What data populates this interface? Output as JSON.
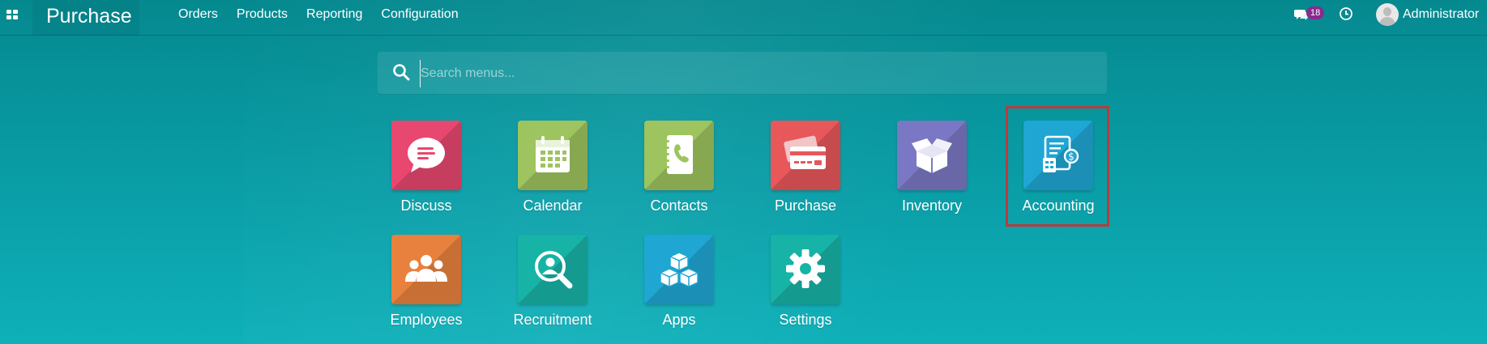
{
  "navbar": {
    "brand": "Purchase",
    "menu": [
      "Orders",
      "Products",
      "Reporting",
      "Configuration"
    ],
    "messages_count": "18",
    "user_name": "Administrator"
  },
  "search": {
    "placeholder": "Search menus..."
  },
  "apps": [
    {
      "label": "Discuss",
      "color": "#e8476f",
      "icon": "discuss-icon"
    },
    {
      "label": "Calendar",
      "color": "#9dc45e",
      "icon": "calendar-icon"
    },
    {
      "label": "Contacts",
      "color": "#9dc45e",
      "icon": "contacts-icon"
    },
    {
      "label": "Purchase",
      "color": "#e8575a",
      "icon": "purchase-icon"
    },
    {
      "label": "Inventory",
      "color": "#7a78c4",
      "icon": "inventory-icon"
    },
    {
      "label": "Accounting",
      "color": "#1fa6d3",
      "icon": "accounting-icon"
    },
    {
      "label": "Employees",
      "color": "#e8813e",
      "icon": "employees-icon"
    },
    {
      "label": "Recruitment",
      "color": "#17b3a6",
      "icon": "recruitment-icon"
    },
    {
      "label": "Apps",
      "color": "#1fa6d3",
      "icon": "apps-icon"
    },
    {
      "label": "Settings",
      "color": "#17b3a6",
      "icon": "settings-icon"
    }
  ],
  "colors": {
    "background": "#0a9ea7",
    "highlight": "#b73d3d",
    "badge": "#8a2a8e"
  }
}
